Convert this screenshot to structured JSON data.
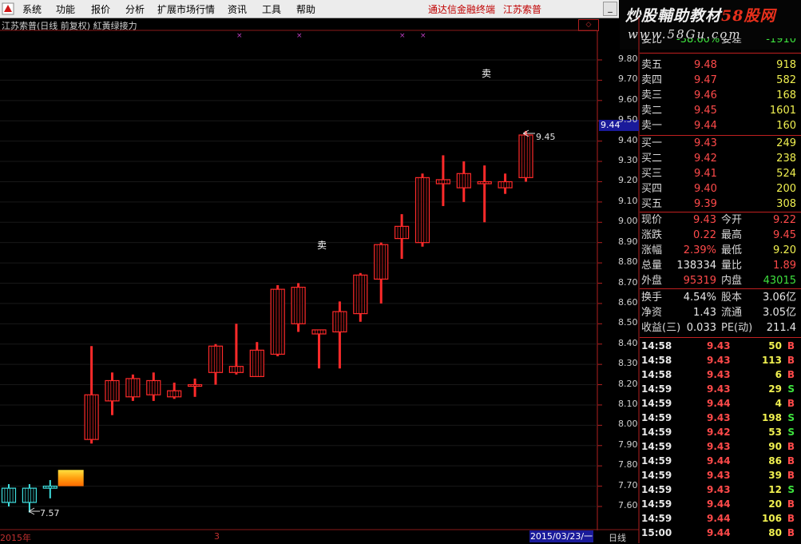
{
  "menu": {
    "items": [
      "系统",
      "功能",
      "报价",
      "分析",
      "扩展市场行情",
      "资讯",
      "工具",
      "帮助"
    ],
    "app_name": "通达信金融终端",
    "stock_name": "江苏索普",
    "minimize_label": "_"
  },
  "watermark": {
    "line1_a": "炒股輔助教材",
    "line1_b": "58股网",
    "line2": "www.58Gu.com"
  },
  "chart": {
    "title": "江苏索普(日线 前复权) 紅黃绿接力",
    "corner_label": "◇",
    "current_price_label": "9.44",
    "sell_signals": [
      "卖",
      "卖"
    ],
    "high_annotation": "9.45",
    "low_annotation": "7.57",
    "purple_marks": [
      "×",
      "×",
      "×",
      "×"
    ],
    "y_ticks": [
      "9.80",
      "9.70",
      "9.60",
      "9.50",
      "9.40",
      "9.30",
      "9.20",
      "9.10",
      "9.00",
      "8.90",
      "8.80",
      "8.70",
      "8.60",
      "8.50",
      "8.40",
      "8.30",
      "8.20",
      "8.10",
      "8.00",
      "7.90",
      "7.80",
      "7.70",
      "7.60"
    ],
    "footer": {
      "year": "2015年",
      "mark": "3",
      "date": "2015/03/23/一",
      "period": "日线"
    }
  },
  "chart_data": {
    "type": "candlestick",
    "ylim": [
      7.55,
      9.85
    ],
    "candles": [
      {
        "o": 7.62,
        "h": 7.71,
        "l": 7.6,
        "c": 7.69,
        "color": "cyan"
      },
      {
        "o": 7.62,
        "h": 7.71,
        "l": 7.57,
        "c": 7.69,
        "color": "cyan"
      },
      {
        "o": 7.69,
        "h": 7.73,
        "l": 7.64,
        "c": 7.7,
        "color": "cyan"
      },
      {
        "o": 7.7,
        "h": 7.78,
        "l": 7.7,
        "c": 7.78,
        "color": "gold"
      },
      {
        "o": 7.93,
        "h": 8.39,
        "l": 7.91,
        "c": 8.15,
        "color": "red"
      },
      {
        "o": 8.12,
        "h": 8.26,
        "l": 8.05,
        "c": 8.22,
        "color": "red"
      },
      {
        "o": 8.14,
        "h": 8.25,
        "l": 8.12,
        "c": 8.23,
        "color": "red"
      },
      {
        "o": 8.15,
        "h": 8.26,
        "l": 8.12,
        "c": 8.22,
        "color": "red"
      },
      {
        "o": 8.14,
        "h": 8.21,
        "l": 8.13,
        "c": 8.17,
        "color": "red"
      },
      {
        "o": 8.2,
        "h": 8.23,
        "l": 8.14,
        "c": 8.2,
        "color": "red"
      },
      {
        "o": 8.26,
        "h": 8.4,
        "l": 8.2,
        "c": 8.39,
        "color": "red"
      },
      {
        "o": 8.26,
        "h": 8.5,
        "l": 8.25,
        "c": 8.29,
        "color": "red"
      },
      {
        "o": 8.24,
        "h": 8.41,
        "l": 8.24,
        "c": 8.37,
        "color": "red"
      },
      {
        "o": 8.35,
        "h": 8.69,
        "l": 8.34,
        "c": 8.67,
        "color": "red"
      },
      {
        "o": 8.5,
        "h": 8.7,
        "l": 8.46,
        "c": 8.68,
        "color": "red"
      },
      {
        "o": 8.47,
        "h": 8.47,
        "l": 8.28,
        "c": 8.45,
        "color": "red"
      },
      {
        "o": 8.46,
        "h": 8.61,
        "l": 8.28,
        "c": 8.56,
        "color": "red"
      },
      {
        "o": 8.55,
        "h": 8.75,
        "l": 8.51,
        "c": 8.74,
        "color": "red"
      },
      {
        "o": 8.72,
        "h": 8.9,
        "l": 8.6,
        "c": 8.89,
        "color": "red"
      },
      {
        "o": 8.92,
        "h": 9.04,
        "l": 8.82,
        "c": 8.98,
        "color": "red"
      },
      {
        "o": 8.9,
        "h": 9.24,
        "l": 8.88,
        "c": 9.22,
        "color": "red"
      },
      {
        "o": 9.19,
        "h": 9.33,
        "l": 9.08,
        "c": 9.21,
        "color": "red"
      },
      {
        "o": 9.17,
        "h": 9.3,
        "l": 9.1,
        "c": 9.24,
        "color": "red"
      },
      {
        "o": 9.19,
        "h": 9.28,
        "l": 9.0,
        "c": 9.2,
        "color": "red"
      },
      {
        "o": 9.17,
        "h": 9.24,
        "l": 9.14,
        "c": 9.2,
        "color": "red"
      },
      {
        "o": 9.22,
        "h": 9.45,
        "l": 9.2,
        "c": 9.43,
        "color": "red"
      }
    ]
  },
  "quote": {
    "top_partial": {
      "label1": "委比",
      "value1": "-38.60%",
      "label2": "委差",
      "value2": "-1910"
    },
    "ask": [
      {
        "label": "卖五",
        "price": "9.48",
        "vol": "918"
      },
      {
        "label": "卖四",
        "price": "9.47",
        "vol": "582"
      },
      {
        "label": "卖三",
        "price": "9.46",
        "vol": "168"
      },
      {
        "label": "卖二",
        "price": "9.45",
        "vol": "1601"
      },
      {
        "label": "卖一",
        "price": "9.44",
        "vol": "160"
      }
    ],
    "bid": [
      {
        "label": "买一",
        "price": "9.43",
        "vol": "249"
      },
      {
        "label": "买二",
        "price": "9.42",
        "vol": "238"
      },
      {
        "label": "买三",
        "price": "9.41",
        "vol": "524"
      },
      {
        "label": "买四",
        "price": "9.40",
        "vol": "200"
      },
      {
        "label": "买五",
        "price": "9.39",
        "vol": "308"
      }
    ],
    "stats1": [
      {
        "l1": "现价",
        "v1": "9.43",
        "c1": "red",
        "l2": "今开",
        "v2": "9.22",
        "c2": "red"
      },
      {
        "l1": "涨跌",
        "v1": "0.22",
        "c1": "red",
        "l2": "最高",
        "v2": "9.45",
        "c2": "red"
      },
      {
        "l1": "涨幅",
        "v1": "2.39%",
        "c1": "red",
        "l2": "最低",
        "v2": "9.20",
        "c2": "yellow"
      },
      {
        "l1": "总量",
        "v1": "138334",
        "c1": "white",
        "l2": "量比",
        "v2": "1.89",
        "c2": "red"
      },
      {
        "l1": "外盘",
        "v1": "95319",
        "c1": "red",
        "l2": "内盘",
        "v2": "43015",
        "c2": "green"
      }
    ],
    "stats2": [
      {
        "l1": "换手",
        "v1": "4.54%",
        "l2": "股本",
        "v2": "3.06亿"
      },
      {
        "l1": "净资",
        "v1": "1.43",
        "l2": "流通",
        "v2": "3.05亿"
      },
      {
        "l1": "收益(三)",
        "v1": "0.033",
        "l2": "PE(动)",
        "v2": "211.4"
      }
    ],
    "ticks": [
      {
        "t": "14:58",
        "p": "9.43",
        "v": "50",
        "d": "B"
      },
      {
        "t": "14:58",
        "p": "9.43",
        "v": "113",
        "d": "B"
      },
      {
        "t": "14:58",
        "p": "9.43",
        "v": "6",
        "d": "B"
      },
      {
        "t": "14:59",
        "p": "9.43",
        "v": "29",
        "d": "S"
      },
      {
        "t": "14:59",
        "p": "9.44",
        "v": "4",
        "d": "B"
      },
      {
        "t": "14:59",
        "p": "9.43",
        "v": "198",
        "d": "S"
      },
      {
        "t": "14:59",
        "p": "9.42",
        "v": "53",
        "d": "S"
      },
      {
        "t": "14:59",
        "p": "9.43",
        "v": "90",
        "d": "B"
      },
      {
        "t": "14:59",
        "p": "9.44",
        "v": "86",
        "d": "B"
      },
      {
        "t": "14:59",
        "p": "9.43",
        "v": "39",
        "d": "B"
      },
      {
        "t": "14:59",
        "p": "9.43",
        "v": "12",
        "d": "S"
      },
      {
        "t": "14:59",
        "p": "9.44",
        "v": "20",
        "d": "B"
      },
      {
        "t": "14:59",
        "p": "9.44",
        "v": "106",
        "d": "B"
      },
      {
        "t": "15:00",
        "p": "9.44",
        "v": "80",
        "d": "B"
      }
    ]
  },
  "colors": {
    "up": "#ff2a2a",
    "down": "#33e5e5",
    "grid": "#1c1c1c",
    "panel_line": "#c02020",
    "gold_top": "#ffe040",
    "gold_bottom": "#ff7a00"
  }
}
